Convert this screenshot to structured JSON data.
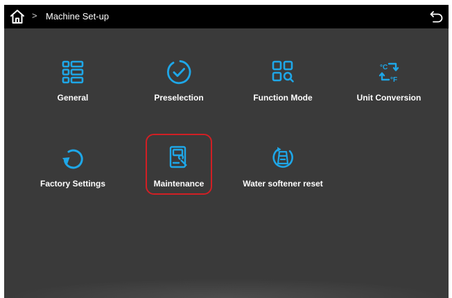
{
  "header": {
    "breadcrumb_sep": ">",
    "title": "Machine Set-up"
  },
  "colors": {
    "accent": "#1ea7e8",
    "highlight": "#d21f24",
    "screen_bg": "#3a3a3a",
    "topbar_bg": "#000000"
  },
  "tiles": [
    {
      "label": "General",
      "icon": "grid-list-icon"
    },
    {
      "label": "Preselection",
      "icon": "check-circle-icon"
    },
    {
      "label": "Function Mode",
      "icon": "grid-search-icon"
    },
    {
      "label": "Unit Conversion",
      "icon": "celsius-fahrenheit-icon"
    },
    {
      "label": "Factory Settings",
      "icon": "reset-arrow-icon"
    },
    {
      "label": "Maintenance",
      "icon": "maintenance-icon"
    },
    {
      "label": "Water softener reset",
      "icon": "water-softener-icon"
    }
  ]
}
